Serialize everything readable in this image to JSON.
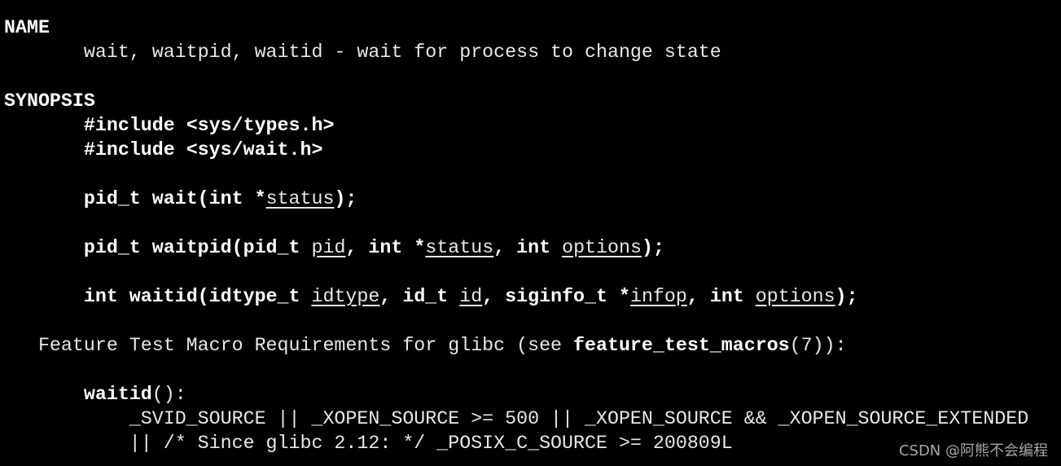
{
  "terminal": {
    "lines": [
      [
        {
          "t": "NAME",
          "s": "b"
        }
      ],
      [
        {
          "t": "       wait, waitpid, waitid - wait for process to change state",
          "s": "n"
        }
      ],
      [],
      [
        {
          "t": "SYNOPSIS",
          "s": "b"
        }
      ],
      [
        {
          "t": "       ",
          "s": "n"
        },
        {
          "t": "#include <sys/types.h>",
          "s": "b"
        }
      ],
      [
        {
          "t": "       ",
          "s": "n"
        },
        {
          "t": "#include <sys/wait.h>",
          "s": "b"
        }
      ],
      [],
      [
        {
          "t": "       ",
          "s": "n"
        },
        {
          "t": "pid_t wait(int *",
          "s": "b"
        },
        {
          "t": "status",
          "s": "u"
        },
        {
          "t": ");",
          "s": "b"
        }
      ],
      [],
      [
        {
          "t": "       ",
          "s": "n"
        },
        {
          "t": "pid_t waitpid(pid_t ",
          "s": "b"
        },
        {
          "t": "pid",
          "s": "u"
        },
        {
          "t": ", int *",
          "s": "b"
        },
        {
          "t": "status",
          "s": "u"
        },
        {
          "t": ", int ",
          "s": "b"
        },
        {
          "t": "options",
          "s": "u"
        },
        {
          "t": ");",
          "s": "b"
        }
      ],
      [],
      [
        {
          "t": "       ",
          "s": "n"
        },
        {
          "t": "int waitid(idtype_t ",
          "s": "b"
        },
        {
          "t": "idtype",
          "s": "u"
        },
        {
          "t": ", id_t ",
          "s": "b"
        },
        {
          "t": "id",
          "s": "u"
        },
        {
          "t": ", siginfo_t *",
          "s": "b"
        },
        {
          "t": "infop",
          "s": "u"
        },
        {
          "t": ", int ",
          "s": "b"
        },
        {
          "t": "options",
          "s": "u"
        },
        {
          "t": ");",
          "s": "b"
        }
      ],
      [],
      [
        {
          "t": "   Feature Test Macro Requirements for glibc (see ",
          "s": "n"
        },
        {
          "t": "feature_test_macros",
          "s": "b"
        },
        {
          "t": "(7)):",
          "s": "n"
        }
      ],
      [],
      [
        {
          "t": "       ",
          "s": "n"
        },
        {
          "t": "waitid",
          "s": "b"
        },
        {
          "t": "():",
          "s": "n"
        }
      ],
      [
        {
          "t": "           _SVID_SOURCE || _XOPEN_SOURCE >= 500 || _XOPEN_SOURCE && _XOPEN_SOURCE_EXTENDED",
          "s": "n"
        }
      ],
      [
        {
          "t": "           || /* Since glibc 2.12: */ _POSIX_C_SOURCE >= 200809L",
          "s": "n"
        }
      ]
    ]
  },
  "watermark": "CSDN @阿熊不会编程",
  "colors": {
    "background": "#000000",
    "text": "#e8e8e8",
    "bold": "#ffffff",
    "watermark": "#a8a8a8"
  }
}
